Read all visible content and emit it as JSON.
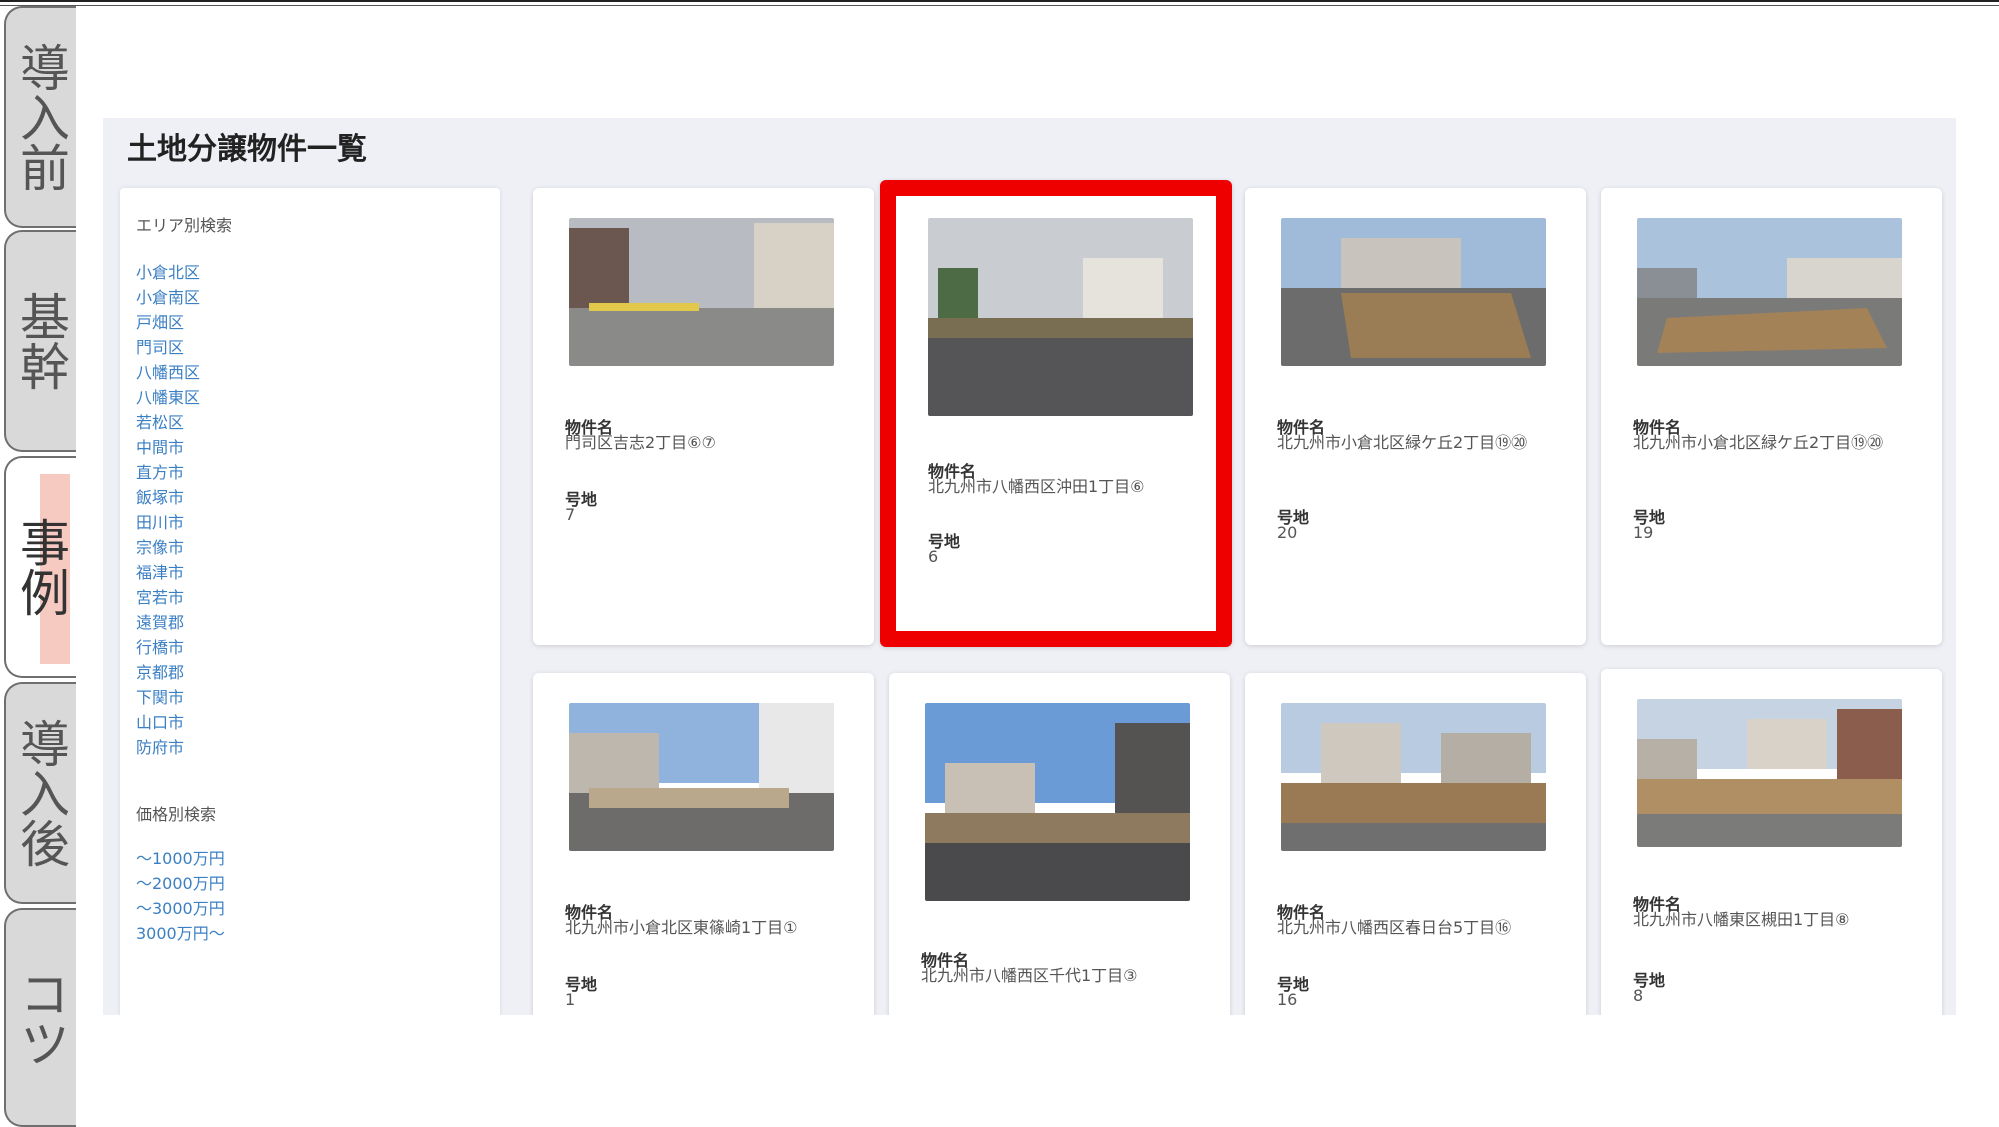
{
  "sidetabs": [
    {
      "label": "導入前",
      "active": false
    },
    {
      "label": "基幹",
      "active": false
    },
    {
      "label": "事例",
      "active": true
    },
    {
      "label": "導入後",
      "active": false
    },
    {
      "label": "コツ",
      "active": false
    }
  ],
  "page": {
    "title": "土地分譲物件一覧"
  },
  "filter": {
    "area_heading": "エリア別検索",
    "areas": [
      "小倉北区",
      "小倉南区",
      "戸畑区",
      "門司区",
      "八幡西区",
      "八幡東区",
      "若松区",
      "中間市",
      "直方市",
      "飯塚市",
      "田川市",
      "宗像市",
      "福津市",
      "宮若市",
      "遠賀郡",
      "行橋市",
      "京都郡",
      "下関市",
      "山口市",
      "防府市"
    ],
    "price_heading": "価格別検索",
    "prices": [
      "～1000万円",
      "～2000万円",
      "～3000万円",
      "3000万円～"
    ]
  },
  "field_labels": {
    "name": "物件名",
    "lot": "号地"
  },
  "listings": [
    {
      "name": "門司区吉志2丁目⑥⑦",
      "lot": "7",
      "selected": false
    },
    {
      "name": "北九州市八幡西区沖田1丁目⑥",
      "lot": "6",
      "selected": true
    },
    {
      "name": "北九州市小倉北区緑ケ丘2丁目⑲⑳",
      "lot": "20",
      "selected": false
    },
    {
      "name": "北九州市小倉北区緑ケ丘2丁目⑲⑳",
      "lot": "19",
      "selected": false
    },
    {
      "name": "北九州市小倉北区東篠崎1丁目①",
      "lot": "1",
      "selected": false
    },
    {
      "name": "北九州市八幡西区千代1丁目③",
      "lot": "",
      "selected": false
    },
    {
      "name": "北九州市八幡西区春日台5丁目⑯",
      "lot": "16",
      "selected": false
    },
    {
      "name": "北九州市八幡東区槻田1丁目⑧",
      "lot": "8",
      "selected": false
    }
  ],
  "colors": {
    "highlight_border": "#ee0000",
    "link": "#3b7fc4",
    "tab_highlight": "#f6c9c1"
  }
}
